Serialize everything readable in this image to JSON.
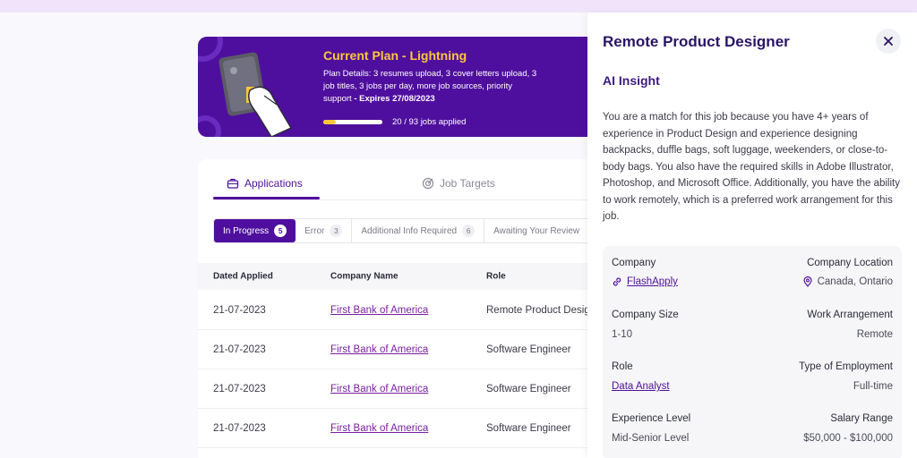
{
  "plan": {
    "title": "Current Plan - Lightning",
    "details": "Plan Details: 3 resumes upload, 3 cover letters upload, 3 job titles, 3 jobs per day, more job sources, priority support",
    "expires": " - Expires 27/08/2023",
    "progress_text": "20 / 93 jobs applied",
    "progress_fraction": 0.215
  },
  "tabs": {
    "applications": "Applications",
    "job_targets": "Job Targets"
  },
  "filters": [
    {
      "label": "In Progress",
      "count": "5"
    },
    {
      "label": "Error",
      "count": "3"
    },
    {
      "label": "Additional Info Required",
      "count": "6"
    },
    {
      "label": "Awaiting Your Review",
      "count": ""
    }
  ],
  "table": {
    "headers": [
      "Dated Applied",
      "Company Name",
      "Role"
    ],
    "rows": [
      {
        "date": "21-07-2023",
        "company": "First Bank of America",
        "role": "Remote Product Designer"
      },
      {
        "date": "21-07-2023",
        "company": "First Bank of America",
        "role": "Software Engineer"
      },
      {
        "date": "21-07-2023",
        "company": "First Bank of America",
        "role": "Software Engineer"
      },
      {
        "date": "21-07-2023",
        "company": "First Bank of America",
        "role": "Software Engineer"
      }
    ]
  },
  "panel": {
    "title": "Remote Product Designer",
    "ai_title": "AI Insight",
    "ai_text": "You are a match for this job because you have 4+ years of experience in Product Design and experience designing backpacks, duffle bags, soft luggage, weekenders, or close-to-body bags. You also have the required skills in Adobe Illustrator, Photoshop, and Microsoft Office. Additionally, you have the ability to work remotely, which is a preferred work arrangement for this job.",
    "company_label": "Company",
    "company_value": "FlashApply",
    "location_label": "Company Location",
    "location_value": "Canada, Ontario",
    "size_label": "Company Size",
    "size_value": "1-10",
    "arrangement_label": "Work Arrangement",
    "arrangement_value": "Remote",
    "role_label": "Role",
    "role_value": "Data Analyst",
    "employment_label": "Type of Employment",
    "employment_value": "Full-time",
    "experience_label": "Experience Level",
    "experience_value": "Mid-Senior Level",
    "salary_label": "Salary Range",
    "salary_value": "$50,000 - $100,000"
  },
  "colors": {
    "brand": "#4f0f9e",
    "accent": "#ffc83a",
    "link": "#7a1fa0"
  }
}
